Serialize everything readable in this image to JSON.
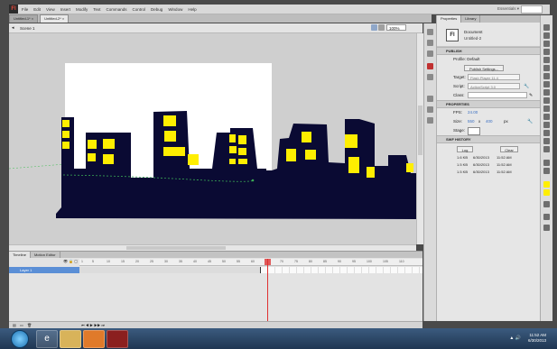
{
  "menubar": {
    "logo": "Fl",
    "items": [
      "File",
      "Edit",
      "View",
      "Insert",
      "Modify",
      "Text",
      "Commands",
      "Control",
      "Debug",
      "Window",
      "Help"
    ],
    "workspace": "Essentials ▾"
  },
  "doc_tabs": [
    "Untitled-1* ×",
    "Untitled-2* ×"
  ],
  "editbar": {
    "scene": "Scene 1",
    "zoom": "100%"
  },
  "properties": {
    "tabs": [
      "Properties",
      "Library"
    ],
    "doc_type": "Document",
    "doc_name": "Untitled-2",
    "publish": {
      "header": "PUBLISH",
      "profile_label": "Profile: Default",
      "publish_settings_button": "Publish Settings...",
      "target_label": "Target:",
      "target_value": "Flash Player 11.4",
      "script_label": "Script:",
      "script_value": "ActionScript 3.0",
      "class_label": "Class:"
    },
    "props": {
      "header": "PROPERTIES",
      "fps_label": "FPS:",
      "fps_value": "24.00",
      "size_label": "Size:",
      "width": "550",
      "x_label": "x",
      "height": "400",
      "unit": "px",
      "stage_label": "Stage:"
    },
    "swf_history": {
      "header": "SWF HISTORY",
      "log_button": "Log",
      "clear_button": "Clear",
      "entries": [
        {
          "size": "1.6 KB",
          "date": "6/30/2013",
          "time": "11:52 AM"
        },
        {
          "size": "1.5 KB",
          "date": "6/30/2013",
          "time": "11:52 AM"
        },
        {
          "size": "1.5 KB",
          "date": "6/30/2013",
          "time": "11:52 AM"
        }
      ]
    }
  },
  "timeline": {
    "tabs": [
      "Timeline",
      "Motion Editor"
    ],
    "ruler": [
      "1",
      "5",
      "10",
      "15",
      "20",
      "25",
      "30",
      "35",
      "40",
      "45",
      "50",
      "55",
      "60",
      "65",
      "70",
      "75",
      "80",
      "85",
      "90",
      "95",
      "100",
      "105",
      "110"
    ],
    "layer_name": "Layer 1",
    "layer_icons": "👁 🔒 ▢"
  },
  "taskbar": {
    "clock_time": "11:52 AM",
    "clock_date": "6/30/2013",
    "tray": "▲ 🔊"
  },
  "colors": {
    "building": "#0a0a33",
    "window": "#ffee00",
    "stage": "#ffffff",
    "motion_path": "#3aaa55"
  }
}
